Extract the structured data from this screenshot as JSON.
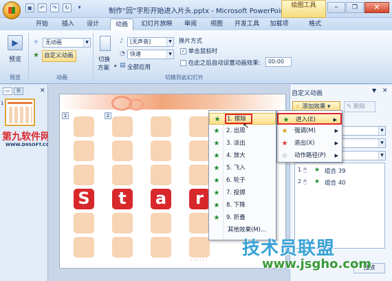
{
  "window": {
    "title": "制作“回”字形开始进入片头.pptx - Microsoft PowerPoint",
    "contextual_tab": "绘图工具"
  },
  "qa": {
    "icons": [
      "save-icon",
      "undo-icon",
      "redo-icon",
      "refresh-icon",
      "customize-icon"
    ]
  },
  "tabs": [
    "开始",
    "插入",
    "设计",
    "动画",
    "幻灯片放映",
    "审阅",
    "视图",
    "开发工具",
    "加载项",
    "格式"
  ],
  "ribbon": {
    "preview": {
      "label": "预览",
      "group": "预览"
    },
    "animation": {
      "combo": "无动画",
      "custom_btn": "自定义动画",
      "group": "动画"
    },
    "switch": {
      "scheme_label1": "切换",
      "scheme_label2": "方案",
      "sound": "[无声音]",
      "speed": "快速",
      "apply_all": "全部应用",
      "section": "换片方式",
      "on_click": "单击鼠标时",
      "after": "在此之后自动设置动画效果:",
      "time": "00:00",
      "group": "切换到此幻灯片"
    }
  },
  "leftpane": {
    "slide_number": "1",
    "logo_main": "第九软件网",
    "logo_url": "WWW.D9SOFT.COM"
  },
  "slide": {
    "letters": [
      "S",
      "t",
      "a",
      "r"
    ],
    "tags": [
      "1",
      "2"
    ]
  },
  "customanim": {
    "title": "自定义动画",
    "add_btn": "添加效果",
    "del_btn": "删除",
    "items": [
      {
        "num": "1",
        "name": "组合 39"
      },
      {
        "num": "2",
        "name": "组合 40"
      }
    ]
  },
  "menu_main": [
    {
      "label": "进入(E)",
      "hl": true
    },
    {
      "label": "强调(M)"
    },
    {
      "label": "退出(X)"
    },
    {
      "label": "动作路径(P)"
    }
  ],
  "menu_sub": [
    {
      "label": "1. 擦除",
      "hl": true
    },
    {
      "label": "2. 出现"
    },
    {
      "label": "3. 淡出"
    },
    {
      "label": "4. 放大"
    },
    {
      "label": "5. 飞入"
    },
    {
      "label": "6. 轮子"
    },
    {
      "label": "7. 投掷"
    },
    {
      "label": "8. 下降"
    },
    {
      "label": "9. 折叠"
    },
    {
      "label": "其他效果(M)..."
    }
  ],
  "watermark": {
    "text": "技术员联盟",
    "url": "www.jsgho.com"
  },
  "colors": {
    "accent_red": "#d8282b",
    "ribbon_blue": "#c5d9f1",
    "highlight": "#fbdf8a"
  }
}
